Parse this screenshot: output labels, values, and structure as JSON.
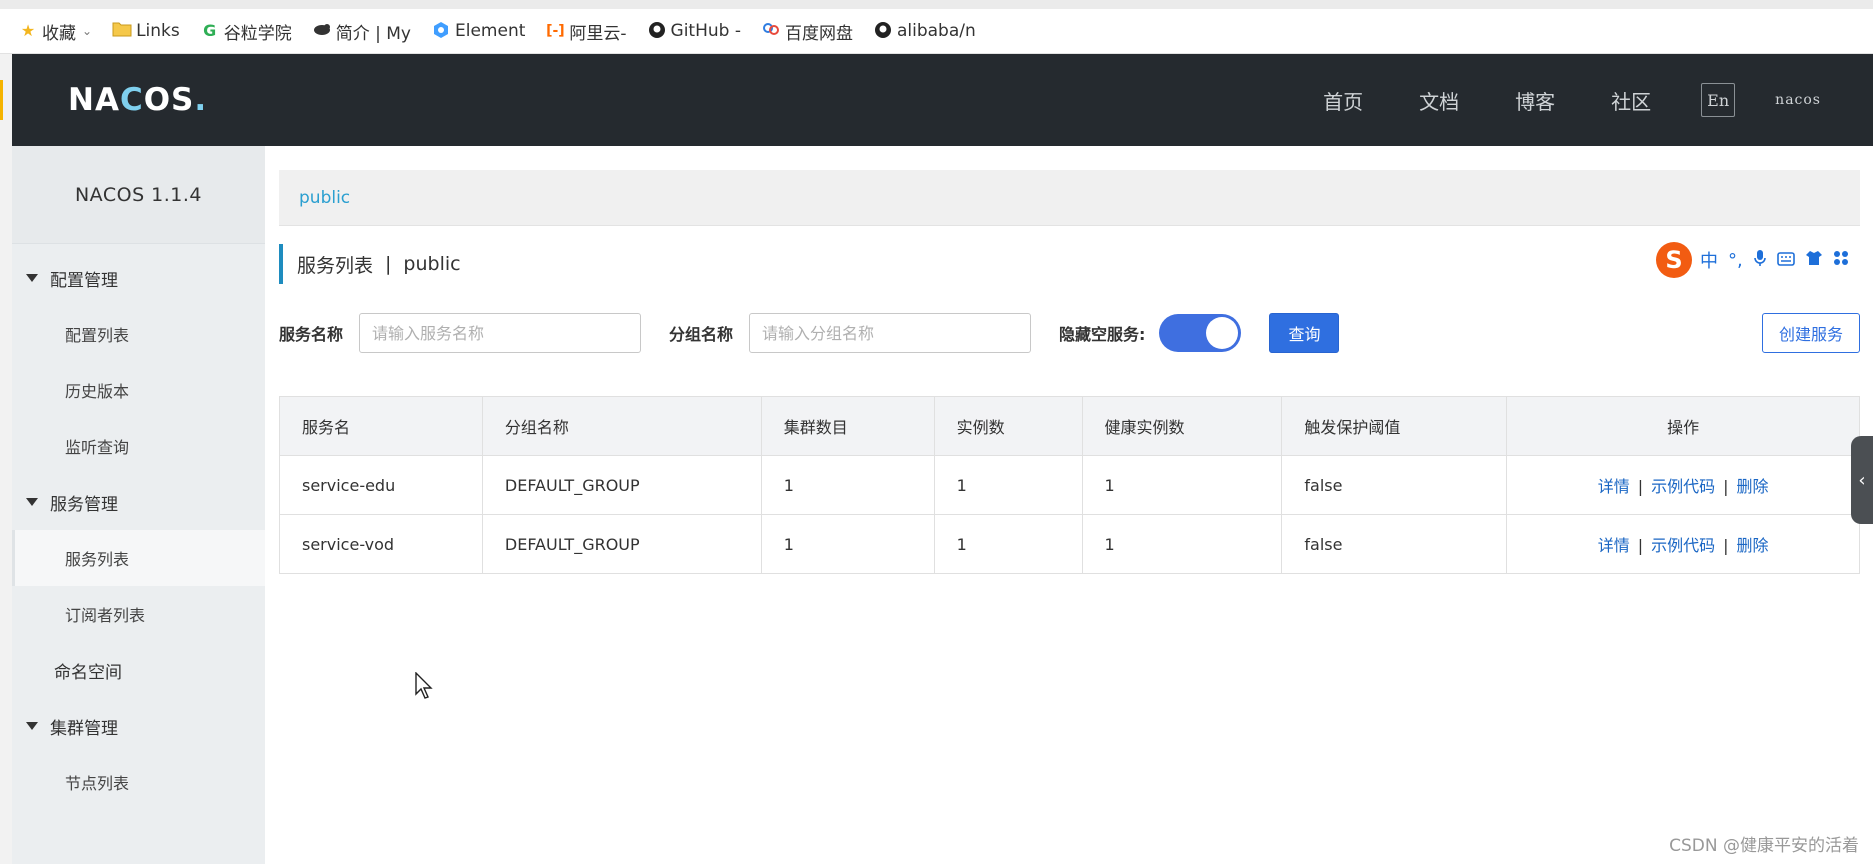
{
  "bookmarks": [
    {
      "label": "收藏",
      "icon": "star-icon"
    },
    {
      "label": "Links",
      "icon": "folder-icon"
    },
    {
      "label": "谷粒学院",
      "icon": "g-logo-icon"
    },
    {
      "label": "简介 | My",
      "icon": "bird-icon"
    },
    {
      "label": "Element",
      "icon": "element-logo-icon"
    },
    {
      "label": "阿里云-",
      "icon": "aliyun-icon"
    },
    {
      "label": "GitHub -",
      "icon": "github-icon"
    },
    {
      "label": "百度网盘",
      "icon": "baidu-cloud-icon"
    },
    {
      "label": "alibaba/n",
      "icon": "github-icon"
    }
  ],
  "header": {
    "logo_main": "NA",
    "logo_c": "C",
    "logo_rest": "OS",
    "logo_dot": ".",
    "nav": [
      "首页",
      "文档",
      "博客",
      "社区"
    ],
    "lang": "En",
    "user": "nacos"
  },
  "sidebar": {
    "version": "NACOS 1.1.4",
    "config_group": "配置管理",
    "config_items": [
      "配置列表",
      "历史版本",
      "监听查询"
    ],
    "service_group": "服务管理",
    "service_items": [
      "服务列表",
      "订阅者列表"
    ],
    "namespace": "命名空间",
    "cluster_group": "集群管理",
    "cluster_items": [
      "节点列表"
    ]
  },
  "main": {
    "namespace_tab": "public",
    "title": "服务列表",
    "title_sep": "|",
    "title_ns": "public",
    "filters": {
      "service_label": "服务名称",
      "service_placeholder": "请输入服务名称",
      "group_label": "分组名称",
      "group_placeholder": "请输入分组名称",
      "hide_empty_label": "隐藏空服务:",
      "hide_empty_on": true,
      "query_button": "查询",
      "create_button": "创建服务"
    },
    "table": {
      "headers": [
        "服务名",
        "分组名称",
        "集群数目",
        "实例数",
        "健康实例数",
        "触发保护阈值",
        "操作"
      ],
      "rows": [
        {
          "name": "service-edu",
          "group": "DEFAULT_GROUP",
          "clusters": "1",
          "instances": "1",
          "healthy": "1",
          "threshold": "false"
        },
        {
          "name": "service-vod",
          "group": "DEFAULT_GROUP",
          "clusters": "1",
          "instances": "1",
          "healthy": "1",
          "threshold": "false"
        }
      ],
      "actions": {
        "detail": "详情",
        "sample": "示例代码",
        "delete": "删除",
        "sep": "|"
      }
    }
  },
  "ime": {
    "logo": "S",
    "lang": "中"
  },
  "watermark": "CSDN @健康平安的活着",
  "colors": {
    "header_bg": "#252a2f",
    "sidebar_bg": "#ebeef0",
    "accent_blue": "#2f6fe0",
    "link_blue": "#1a66c4",
    "namespace_cyan": "#2a9fd0"
  }
}
